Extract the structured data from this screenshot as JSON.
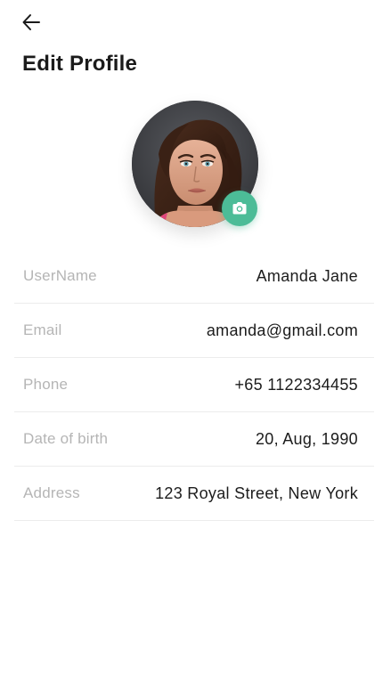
{
  "header": {
    "back_icon": "arrow-left-icon",
    "title": "Edit Profile"
  },
  "profile": {
    "avatar_icon": "user-photo",
    "camera_icon": "camera-icon",
    "accent_color": "#4cbc97"
  },
  "fields": [
    {
      "label": "UserName",
      "value": "Amanda Jane"
    },
    {
      "label": "Email",
      "value": "amanda@gmail.com"
    },
    {
      "label": "Phone",
      "value": "+65 1122334455"
    },
    {
      "label": "Date of birth",
      "value": "20, Aug, 1990"
    },
    {
      "label": "Address",
      "value": "123 Royal Street, New York"
    }
  ]
}
